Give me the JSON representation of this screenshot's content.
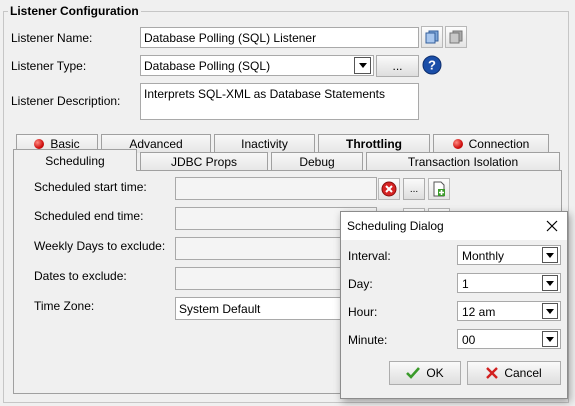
{
  "group": {
    "title": "Listener Configuration"
  },
  "form": {
    "name_label": "Listener Name:",
    "name_value": "Database Polling (SQL) Listener",
    "type_label": "Listener Type:",
    "type_value": "Database Polling (SQL)",
    "type_browse": "...",
    "desc_label": "Listener Description:",
    "desc_value": "Interprets SQL-XML as Database Statements"
  },
  "tabs_row1": [
    {
      "label": "Basic",
      "status": "error"
    },
    {
      "label": "Advanced"
    },
    {
      "label": "Inactivity"
    },
    {
      "label": "Throttling"
    },
    {
      "label": "Connection",
      "status": "error"
    }
  ],
  "tabs_row2": [
    {
      "label": "Scheduling",
      "active": true
    },
    {
      "label": "JDBC Props"
    },
    {
      "label": "Debug"
    },
    {
      "label": "Transaction Isolation"
    }
  ],
  "scheduling": {
    "start_label": "Scheduled start time:",
    "start_value": "",
    "end_label": "Scheduled end time:",
    "end_value": "",
    "weekly_label": "Weekly Days to exclude:",
    "dates_label": "Dates to exclude:",
    "tz_label": "Time Zone:",
    "tz_value": "System Default",
    "browse": "..."
  },
  "dialog": {
    "title": "Scheduling Dialog",
    "interval_label": "Interval:",
    "interval_value": "Monthly",
    "day_label": "Day:",
    "day_value": "1",
    "hour_label": "Hour:",
    "hour_value": "12 am",
    "minute_label": "Minute:",
    "minute_value": "00",
    "ok_label": "OK",
    "cancel_label": "Cancel"
  },
  "colors": {
    "help_icon": "#1a4ea8",
    "ok_check": "#3a9a2a",
    "cancel_x": "#d22020",
    "error_dot": "#d01010"
  }
}
